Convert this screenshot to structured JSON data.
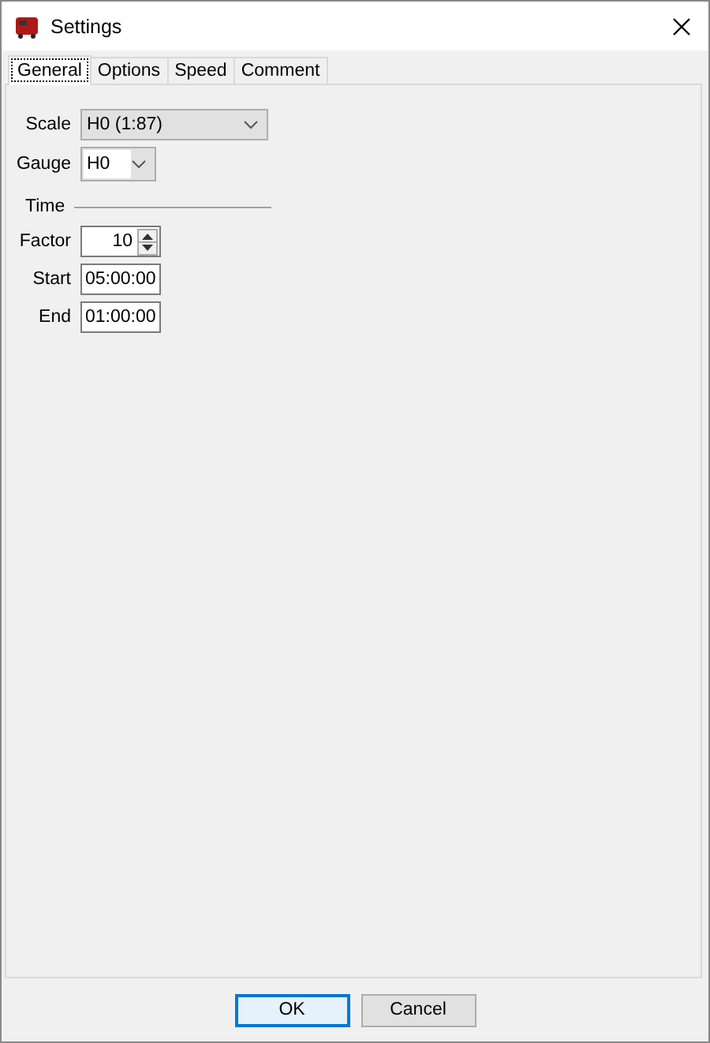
{
  "window": {
    "title": "Settings"
  },
  "tabs": [
    {
      "label": "General",
      "selected": true
    },
    {
      "label": "Options",
      "selected": false
    },
    {
      "label": "Speed",
      "selected": false
    },
    {
      "label": "Comment",
      "selected": false
    }
  ],
  "scale": {
    "label": "Scale",
    "value": "H0 (1:87)"
  },
  "gauge": {
    "label": "Gauge",
    "value": "H0"
  },
  "time": {
    "heading": "Time",
    "factor": {
      "label": "Factor",
      "value": "10"
    },
    "start": {
      "label": "Start",
      "value": "05:00:00"
    },
    "end": {
      "label": "End",
      "value": "01:00:00"
    }
  },
  "buttons": [
    {
      "label": "OK",
      "kind": "default"
    },
    {
      "label": "Cancel",
      "kind": "normal"
    }
  ]
}
